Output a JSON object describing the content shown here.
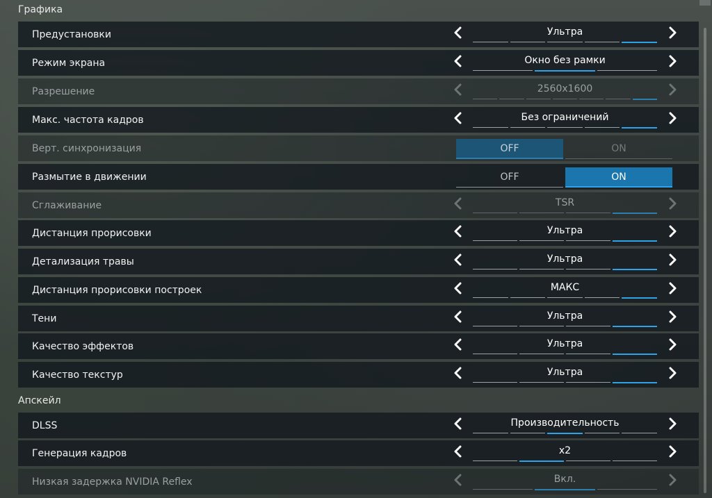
{
  "sections": {
    "graphics_title": "Графика",
    "upscale_title": "Апскейл"
  },
  "rows": [
    {
      "label": "Предустановки",
      "type": "selector",
      "value": "Ультра",
      "segments": 5,
      "active": 4,
      "disabled": false
    },
    {
      "label": "Режим экрана",
      "type": "selector",
      "value": "Окно без рамки",
      "segments": 3,
      "active": 1,
      "disabled": false
    },
    {
      "label": "Разрешение",
      "type": "selector",
      "value": "2560x1600",
      "segments": 7,
      "active": 6,
      "disabled": true
    },
    {
      "label": "Макс. частота кадров",
      "type": "selector",
      "value": "Без ограничений",
      "segments": 5,
      "active": 4,
      "disabled": false
    },
    {
      "label": "Верт. синхронизация",
      "type": "toggle",
      "off": "OFF",
      "on": "ON",
      "selected": "off",
      "disabled": true
    },
    {
      "label": "Размытие в движении",
      "type": "toggle",
      "off": "OFF",
      "on": "ON",
      "selected": "on",
      "disabled": false
    },
    {
      "label": "Сглаживание",
      "type": "selector",
      "value": "TSR",
      "segments": 4,
      "active": 3,
      "disabled": true
    },
    {
      "label": "Дистанция прорисовки",
      "type": "selector",
      "value": "Ультра",
      "segments": 4,
      "active": 3,
      "disabled": false
    },
    {
      "label": "Детализация травы",
      "type": "selector",
      "value": "Ультра",
      "segments": 4,
      "active": 3,
      "disabled": false
    },
    {
      "label": "Дистанция прорисовки построек",
      "type": "selector",
      "value": "МАКС",
      "segments": 5,
      "active": 4,
      "disabled": false
    },
    {
      "label": "Тени",
      "type": "selector",
      "value": "Ультра",
      "segments": 4,
      "active": 3,
      "disabled": false
    },
    {
      "label": "Качество эффектов",
      "type": "selector",
      "value": "Ультра",
      "segments": 4,
      "active": 3,
      "disabled": false
    },
    {
      "label": "Качество текстур",
      "type": "selector",
      "value": "Ультра",
      "segments": 4,
      "active": 3,
      "disabled": false
    },
    {
      "label": "DLSS",
      "type": "selector",
      "value": "Производительность",
      "segments": 5,
      "active": 2,
      "disabled": false
    },
    {
      "label": "Генерация кадров",
      "type": "selector",
      "value": "x2",
      "segments": 4,
      "active": 1,
      "disabled": false
    },
    {
      "label": "Низкая задержка NVIDIA Reflex",
      "type": "selector",
      "value": "Вкл.",
      "segments": 3,
      "active": 1,
      "disabled": true
    }
  ],
  "colors": {
    "accent": "#2ea3e6",
    "toggle_selected": "#1a76ac",
    "row_bg": "#141a1e"
  },
  "icons": {
    "prev": "chevron-left-icon",
    "next": "chevron-right-icon"
  }
}
